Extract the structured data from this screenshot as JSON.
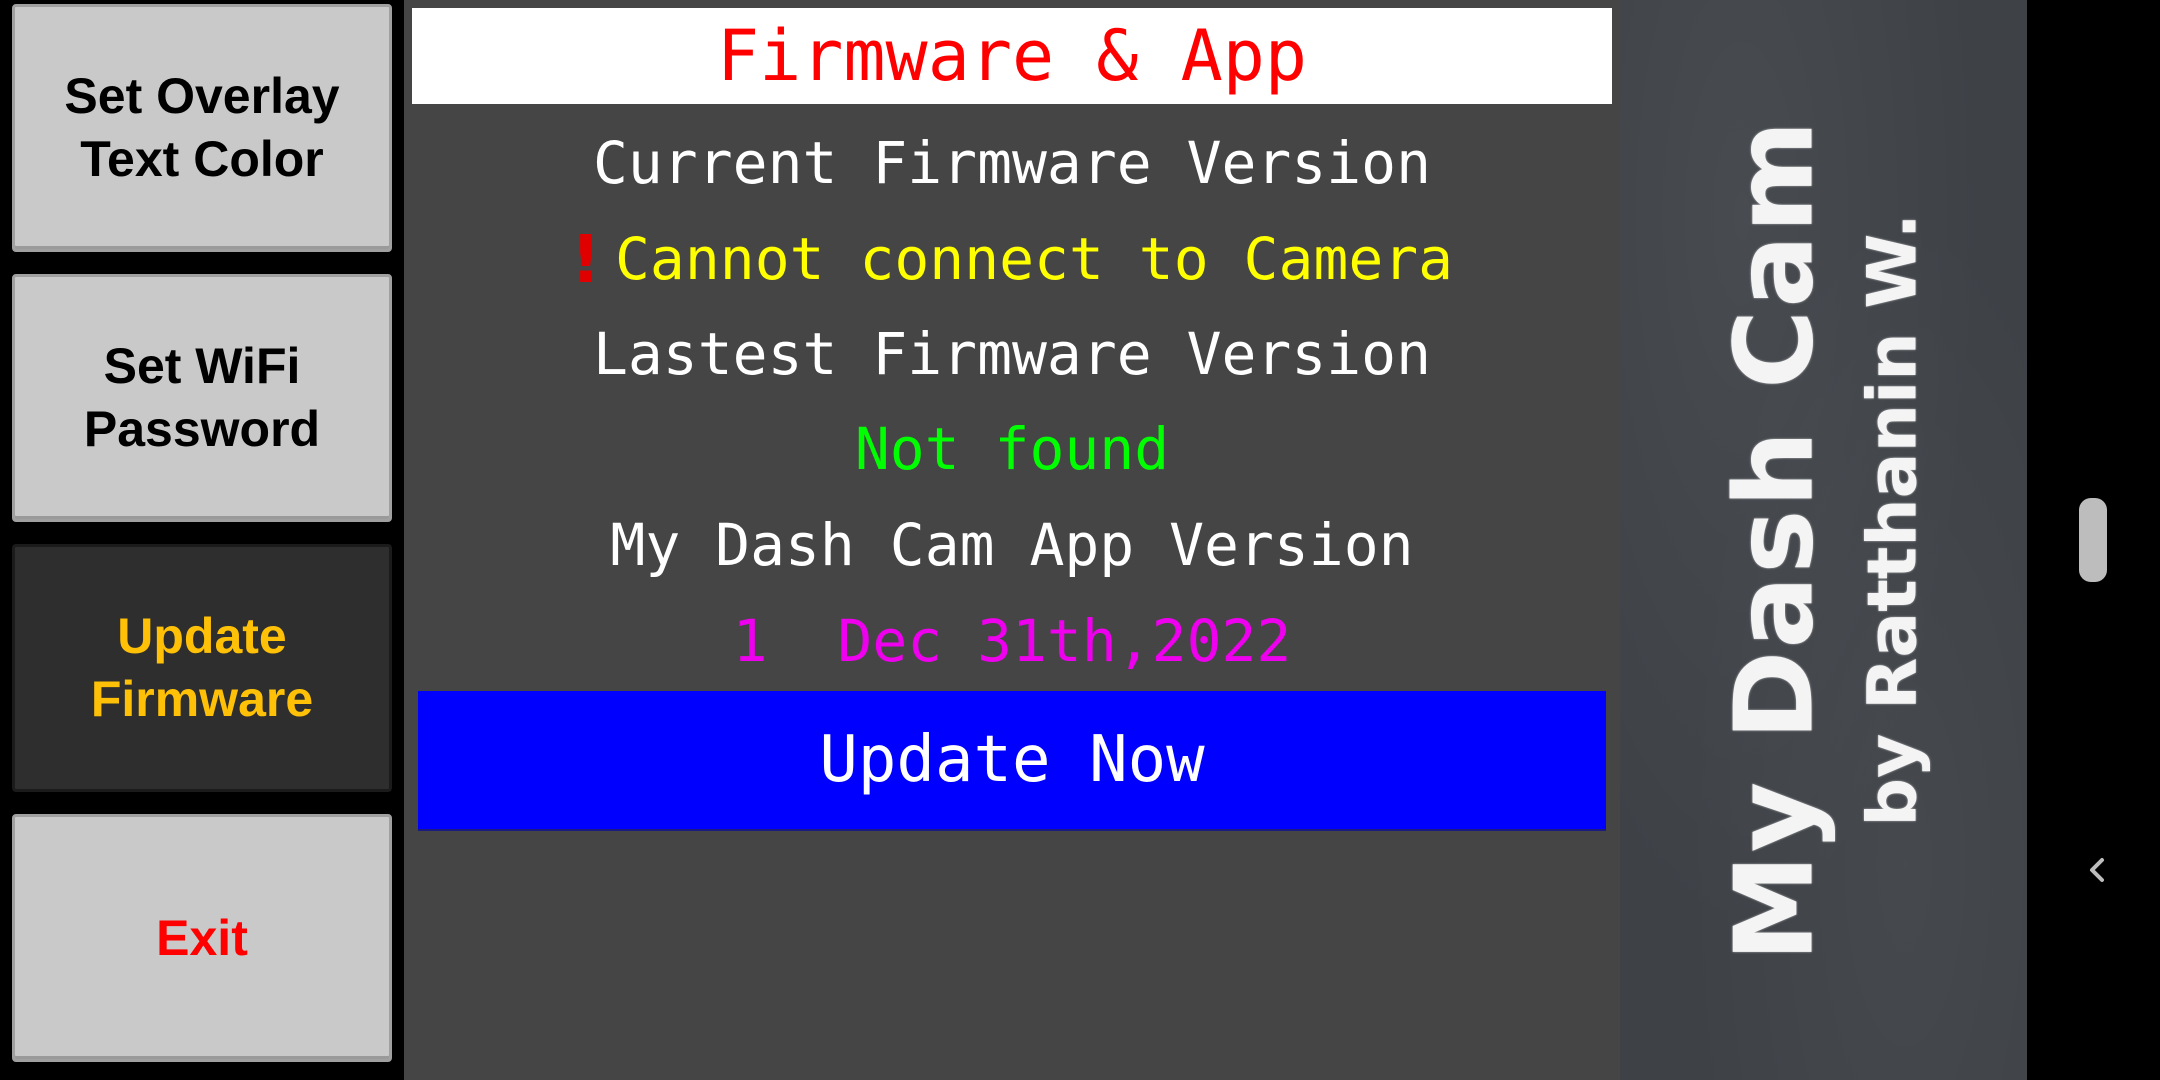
{
  "menu": {
    "items": [
      {
        "label": "Set Overlay\nText Color"
      },
      {
        "label": "Set WiFi\nPassword"
      },
      {
        "label": "Update\nFirmware",
        "selected": true
      },
      {
        "label": "Exit"
      }
    ]
  },
  "panel": {
    "title": "Firmware & App",
    "current_firmware_label": "Current Firmware Version",
    "current_firmware_value": "Cannot connect to Camera",
    "latest_firmware_label": "Lastest Firmware Version",
    "latest_firmware_value": "Not found",
    "app_version_label": "My Dash Cam App Version",
    "app_version_value": "1  Dec 31th,2022",
    "update_button": "Update Now",
    "warning_icon": "exclamation-icon"
  },
  "branding": {
    "title": "My Dash Cam",
    "byline": "by Ratthanin W."
  },
  "colors": {
    "title": "#ff0000",
    "warning": "#ffff00",
    "not_found": "#00ff00",
    "app_version": "#ee00ee",
    "update_button": "#0000ff",
    "selected_menu_text": "#ffc107",
    "exit_text": "#ff0000"
  }
}
